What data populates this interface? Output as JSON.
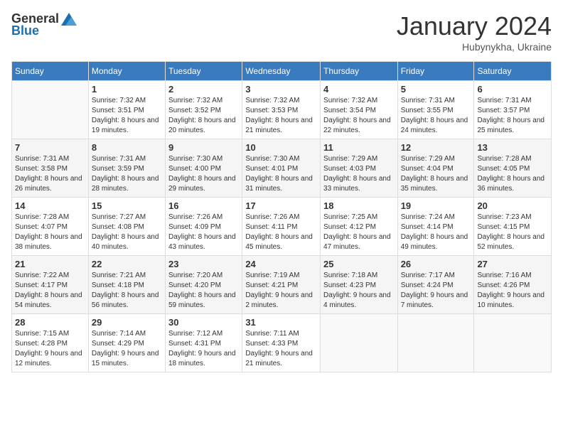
{
  "logo": {
    "general": "General",
    "blue": "Blue"
  },
  "title": "January 2024",
  "subtitle": "Hubynykha, Ukraine",
  "days_of_week": [
    "Sunday",
    "Monday",
    "Tuesday",
    "Wednesday",
    "Thursday",
    "Friday",
    "Saturday"
  ],
  "weeks": [
    [
      {
        "day": "",
        "sunrise": "",
        "sunset": "",
        "daylight": ""
      },
      {
        "day": "1",
        "sunrise": "Sunrise: 7:32 AM",
        "sunset": "Sunset: 3:51 PM",
        "daylight": "Daylight: 8 hours and 19 minutes."
      },
      {
        "day": "2",
        "sunrise": "Sunrise: 7:32 AM",
        "sunset": "Sunset: 3:52 PM",
        "daylight": "Daylight: 8 hours and 20 minutes."
      },
      {
        "day": "3",
        "sunrise": "Sunrise: 7:32 AM",
        "sunset": "Sunset: 3:53 PM",
        "daylight": "Daylight: 8 hours and 21 minutes."
      },
      {
        "day": "4",
        "sunrise": "Sunrise: 7:32 AM",
        "sunset": "Sunset: 3:54 PM",
        "daylight": "Daylight: 8 hours and 22 minutes."
      },
      {
        "day": "5",
        "sunrise": "Sunrise: 7:31 AM",
        "sunset": "Sunset: 3:55 PM",
        "daylight": "Daylight: 8 hours and 24 minutes."
      },
      {
        "day": "6",
        "sunrise": "Sunrise: 7:31 AM",
        "sunset": "Sunset: 3:57 PM",
        "daylight": "Daylight: 8 hours and 25 minutes."
      }
    ],
    [
      {
        "day": "7",
        "sunrise": "Sunrise: 7:31 AM",
        "sunset": "Sunset: 3:58 PM",
        "daylight": "Daylight: 8 hours and 26 minutes."
      },
      {
        "day": "8",
        "sunrise": "Sunrise: 7:31 AM",
        "sunset": "Sunset: 3:59 PM",
        "daylight": "Daylight: 8 hours and 28 minutes."
      },
      {
        "day": "9",
        "sunrise": "Sunrise: 7:30 AM",
        "sunset": "Sunset: 4:00 PM",
        "daylight": "Daylight: 8 hours and 29 minutes."
      },
      {
        "day": "10",
        "sunrise": "Sunrise: 7:30 AM",
        "sunset": "Sunset: 4:01 PM",
        "daylight": "Daylight: 8 hours and 31 minutes."
      },
      {
        "day": "11",
        "sunrise": "Sunrise: 7:29 AM",
        "sunset": "Sunset: 4:03 PM",
        "daylight": "Daylight: 8 hours and 33 minutes."
      },
      {
        "day": "12",
        "sunrise": "Sunrise: 7:29 AM",
        "sunset": "Sunset: 4:04 PM",
        "daylight": "Daylight: 8 hours and 35 minutes."
      },
      {
        "day": "13",
        "sunrise": "Sunrise: 7:28 AM",
        "sunset": "Sunset: 4:05 PM",
        "daylight": "Daylight: 8 hours and 36 minutes."
      }
    ],
    [
      {
        "day": "14",
        "sunrise": "Sunrise: 7:28 AM",
        "sunset": "Sunset: 4:07 PM",
        "daylight": "Daylight: 8 hours and 38 minutes."
      },
      {
        "day": "15",
        "sunrise": "Sunrise: 7:27 AM",
        "sunset": "Sunset: 4:08 PM",
        "daylight": "Daylight: 8 hours and 40 minutes."
      },
      {
        "day": "16",
        "sunrise": "Sunrise: 7:26 AM",
        "sunset": "Sunset: 4:09 PM",
        "daylight": "Daylight: 8 hours and 43 minutes."
      },
      {
        "day": "17",
        "sunrise": "Sunrise: 7:26 AM",
        "sunset": "Sunset: 4:11 PM",
        "daylight": "Daylight: 8 hours and 45 minutes."
      },
      {
        "day": "18",
        "sunrise": "Sunrise: 7:25 AM",
        "sunset": "Sunset: 4:12 PM",
        "daylight": "Daylight: 8 hours and 47 minutes."
      },
      {
        "day": "19",
        "sunrise": "Sunrise: 7:24 AM",
        "sunset": "Sunset: 4:14 PM",
        "daylight": "Daylight: 8 hours and 49 minutes."
      },
      {
        "day": "20",
        "sunrise": "Sunrise: 7:23 AM",
        "sunset": "Sunset: 4:15 PM",
        "daylight": "Daylight: 8 hours and 52 minutes."
      }
    ],
    [
      {
        "day": "21",
        "sunrise": "Sunrise: 7:22 AM",
        "sunset": "Sunset: 4:17 PM",
        "daylight": "Daylight: 8 hours and 54 minutes."
      },
      {
        "day": "22",
        "sunrise": "Sunrise: 7:21 AM",
        "sunset": "Sunset: 4:18 PM",
        "daylight": "Daylight: 8 hours and 56 minutes."
      },
      {
        "day": "23",
        "sunrise": "Sunrise: 7:20 AM",
        "sunset": "Sunset: 4:20 PM",
        "daylight": "Daylight: 8 hours and 59 minutes."
      },
      {
        "day": "24",
        "sunrise": "Sunrise: 7:19 AM",
        "sunset": "Sunset: 4:21 PM",
        "daylight": "Daylight: 9 hours and 2 minutes."
      },
      {
        "day": "25",
        "sunrise": "Sunrise: 7:18 AM",
        "sunset": "Sunset: 4:23 PM",
        "daylight": "Daylight: 9 hours and 4 minutes."
      },
      {
        "day": "26",
        "sunrise": "Sunrise: 7:17 AM",
        "sunset": "Sunset: 4:24 PM",
        "daylight": "Daylight: 9 hours and 7 minutes."
      },
      {
        "day": "27",
        "sunrise": "Sunrise: 7:16 AM",
        "sunset": "Sunset: 4:26 PM",
        "daylight": "Daylight: 9 hours and 10 minutes."
      }
    ],
    [
      {
        "day": "28",
        "sunrise": "Sunrise: 7:15 AM",
        "sunset": "Sunset: 4:28 PM",
        "daylight": "Daylight: 9 hours and 12 minutes."
      },
      {
        "day": "29",
        "sunrise": "Sunrise: 7:14 AM",
        "sunset": "Sunset: 4:29 PM",
        "daylight": "Daylight: 9 hours and 15 minutes."
      },
      {
        "day": "30",
        "sunrise": "Sunrise: 7:12 AM",
        "sunset": "Sunset: 4:31 PM",
        "daylight": "Daylight: 9 hours and 18 minutes."
      },
      {
        "day": "31",
        "sunrise": "Sunrise: 7:11 AM",
        "sunset": "Sunset: 4:33 PM",
        "daylight": "Daylight: 9 hours and 21 minutes."
      },
      {
        "day": "",
        "sunrise": "",
        "sunset": "",
        "daylight": ""
      },
      {
        "day": "",
        "sunrise": "",
        "sunset": "",
        "daylight": ""
      },
      {
        "day": "",
        "sunrise": "",
        "sunset": "",
        "daylight": ""
      }
    ]
  ]
}
